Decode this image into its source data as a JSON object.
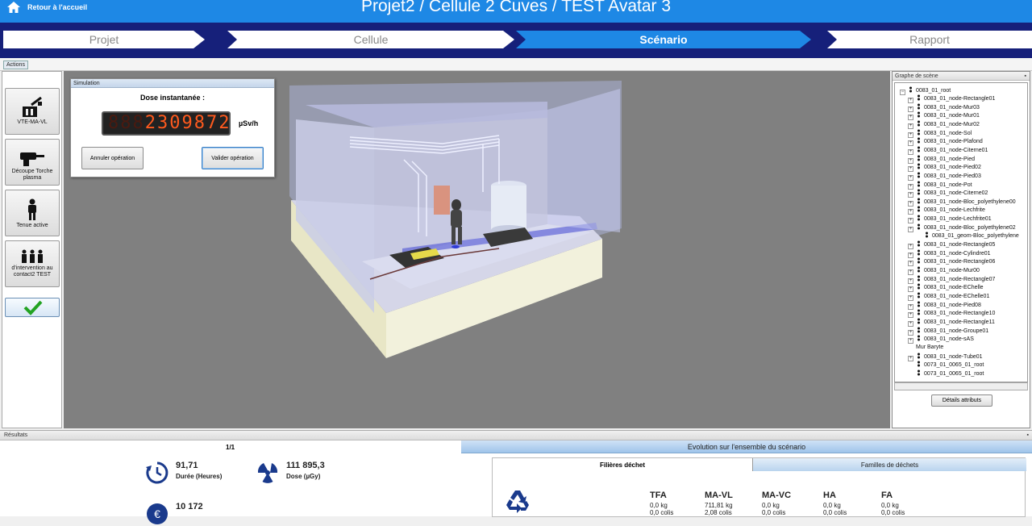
{
  "header": {
    "home_label": "Retour à l'accueil",
    "title": "Projet2 / Cellule 2 Cuves / TEST Avatar 3"
  },
  "steps": [
    {
      "label": "Projet"
    },
    {
      "label": "Cellule"
    },
    {
      "label": "Scénario"
    },
    {
      "label": "Rapport"
    }
  ],
  "toolbar": {
    "actions_tab": "Actions"
  },
  "actions": [
    {
      "label": "VTE-MA-VL"
    },
    {
      "label": "Découpe Torche plasma"
    },
    {
      "label": "Tenue active"
    },
    {
      "label": "d'intervention au contact2 TEST"
    }
  ],
  "simulation": {
    "panel_title": "Simulation",
    "title": "Dose instantanée :",
    "led_dim": "888",
    "led_value": "2309872",
    "unit": "µSv/h",
    "cancel_label": "Annuler opération",
    "validate_label": "Valider opération"
  },
  "scene_graph": {
    "title": "Graphe de scène",
    "root": "0083_01_root",
    "nodes": [
      "0083_01_node-Rectangle01",
      "0083_01_node-Mur03",
      "0083_01_node-Mur01",
      "0083_01_node-Mur02",
      "0083_01_node-Sol",
      "0083_01_node-Plafond",
      "0083_01_node-Citerne01",
      "0083_01_node-Pied",
      "0083_01_node-Pied02",
      "0083_01_node-Pied03",
      "0083_01_node-Pot",
      "0083_01_node-Citerne02",
      "0083_01_node-Bloc_polyethylene00",
      "0083_01_node-Lechfrite",
      "0083_01_node-Lechfrite01",
      "0083_01_node-Bloc_polyethylene02",
      "0083_01_geom-Bloc_polyethylene",
      "0083_01_node-Rectangle05",
      "0083_01_node-Cylindre01",
      "0083_01_node-Rectangle06",
      "0083_01_node-Mur00",
      "0083_01_node-Rectangle07",
      "0083_01_node-EChelle",
      "0083_01_node-EChelle01",
      "0083_01_node-Pied08",
      "0083_01_node-Rectangle10",
      "0083_01_node-Rectangle11",
      "0083_01_node-Groupe01",
      "0083_01_node-sAS",
      "Mur Baryte",
      "0083_01_node-Tube01",
      "0073_01_0065_01_root",
      "0073_01_0065_01_root"
    ],
    "details_label": "Détails attributs"
  },
  "results": {
    "title": "Résultats",
    "page": "1/1",
    "evolution_label": "Evolution sur l'ensemble du scénario",
    "duration_value": "91,71",
    "duration_caption": "Durée (Heures)",
    "dose_value": "111 895,3",
    "dose_caption": "Dose (µGy)",
    "cost_value": "10 172",
    "tabs": {
      "active": "Filières déchet",
      "inactive": "Familles de déchets"
    },
    "waste": [
      {
        "name": "TFA",
        "kg": "0,0 kg",
        "colis": "0,0 colis"
      },
      {
        "name": "MA-VL",
        "kg": "711,81 kg",
        "colis": "2,08 colis"
      },
      {
        "name": "MA-VC",
        "kg": "0,0 kg",
        "colis": "0,0 colis"
      },
      {
        "name": "HA",
        "kg": "0,0 kg",
        "colis": "0,0 colis"
      },
      {
        "name": "FA",
        "kg": "0,0 kg",
        "colis": "0,0 colis"
      }
    ]
  },
  "colors": {
    "header_blue": "#1e88e5",
    "steps_navy": "#16207a",
    "led_orange": "#ff5a1e"
  }
}
